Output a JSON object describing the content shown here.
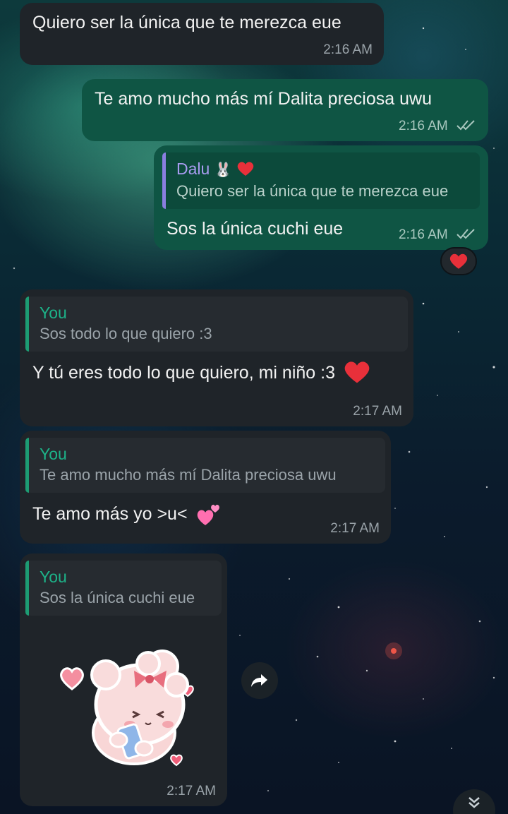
{
  "messages": [
    {
      "text": "Quiero ser la única que te merezca eue",
      "time": "2:16 AM"
    },
    {
      "text": "Te amo mucho más mí Dalita preciosa uwu",
      "time": "2:16 AM"
    },
    {
      "quote_name": "Dalu",
      "quote_text": "Quiero ser la única que te merezca eue",
      "text": "Sos la única cuchi eue",
      "time": "2:16 AM",
      "reaction": "red-heart"
    },
    {
      "quote_name": "You",
      "quote_text": "Sos todo lo que quiero :3",
      "text": "Y tú eres todo lo que quiero, mi niño :3",
      "time": "2:17 AM"
    },
    {
      "quote_name": "You",
      "quote_text": "Te amo mucho más mí Dalita preciosa uwu",
      "text": "Te amo más yo >u<",
      "time": "2:17 AM"
    },
    {
      "quote_name": "You",
      "quote_text": "Sos la única cuchi eue",
      "sticker": "pink-bear-phone-sticker",
      "time": "2:17 AM"
    }
  ],
  "icons": {
    "read_receipt": "double-check-icon",
    "forward": "forward-icon",
    "scroll_down": "chevron-double-down-icon"
  },
  "colors": {
    "incoming_bubble": "#1f2429",
    "outgoing_bubble": "#0f5544",
    "you_name": "#1db389",
    "dalu_name": "#a89cf0"
  }
}
